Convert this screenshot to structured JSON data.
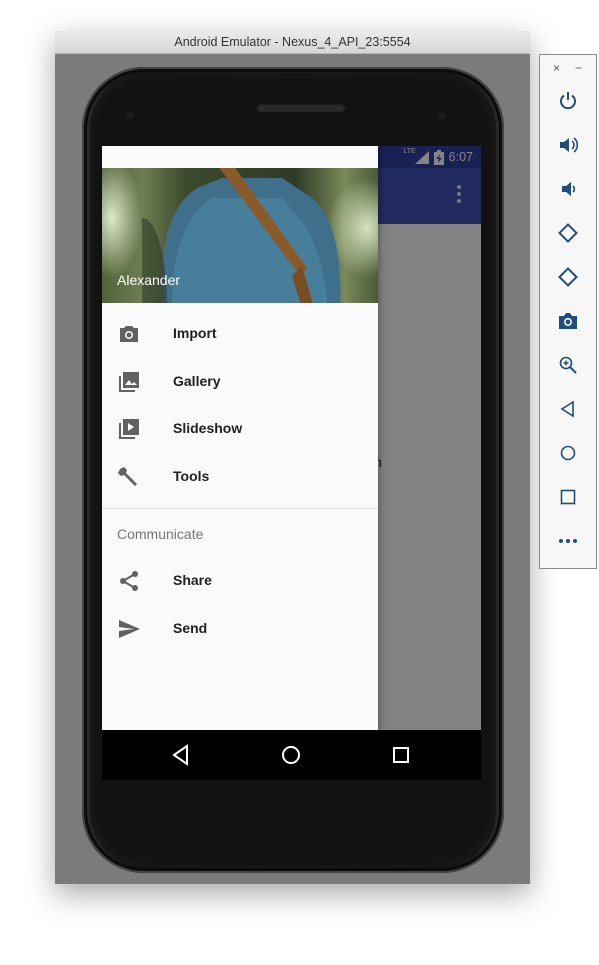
{
  "window": {
    "title": "Android Emulator - Nexus_4_API_23:5554"
  },
  "status_bar": {
    "network": "LTE",
    "time": "6:07"
  },
  "app": {
    "content_text": "h"
  },
  "drawer": {
    "header_name": "Alexander",
    "items": [
      {
        "label": "Import",
        "icon": "camera-icon"
      },
      {
        "label": "Gallery",
        "icon": "gallery-icon"
      },
      {
        "label": "Slideshow",
        "icon": "slideshow-icon"
      },
      {
        "label": "Tools",
        "icon": "wrench-icon"
      }
    ],
    "subheader": "Communicate",
    "communicate_items": [
      {
        "label": "Share",
        "icon": "share-icon"
      },
      {
        "label": "Send",
        "icon": "send-icon"
      }
    ]
  },
  "side_toolbar": {
    "close_symbol": "×",
    "minimize_symbol": "−",
    "buttons": [
      "power-icon",
      "volume-up-icon",
      "volume-down-icon",
      "rotate-left-icon",
      "rotate-right-icon",
      "screenshot-icon",
      "zoom-icon",
      "back-icon",
      "home-icon",
      "overview-icon",
      "more-icon"
    ]
  },
  "colors": {
    "primary": "#3f51b5",
    "primary_dark": "#303f9f",
    "accent": "#ff4081"
  }
}
